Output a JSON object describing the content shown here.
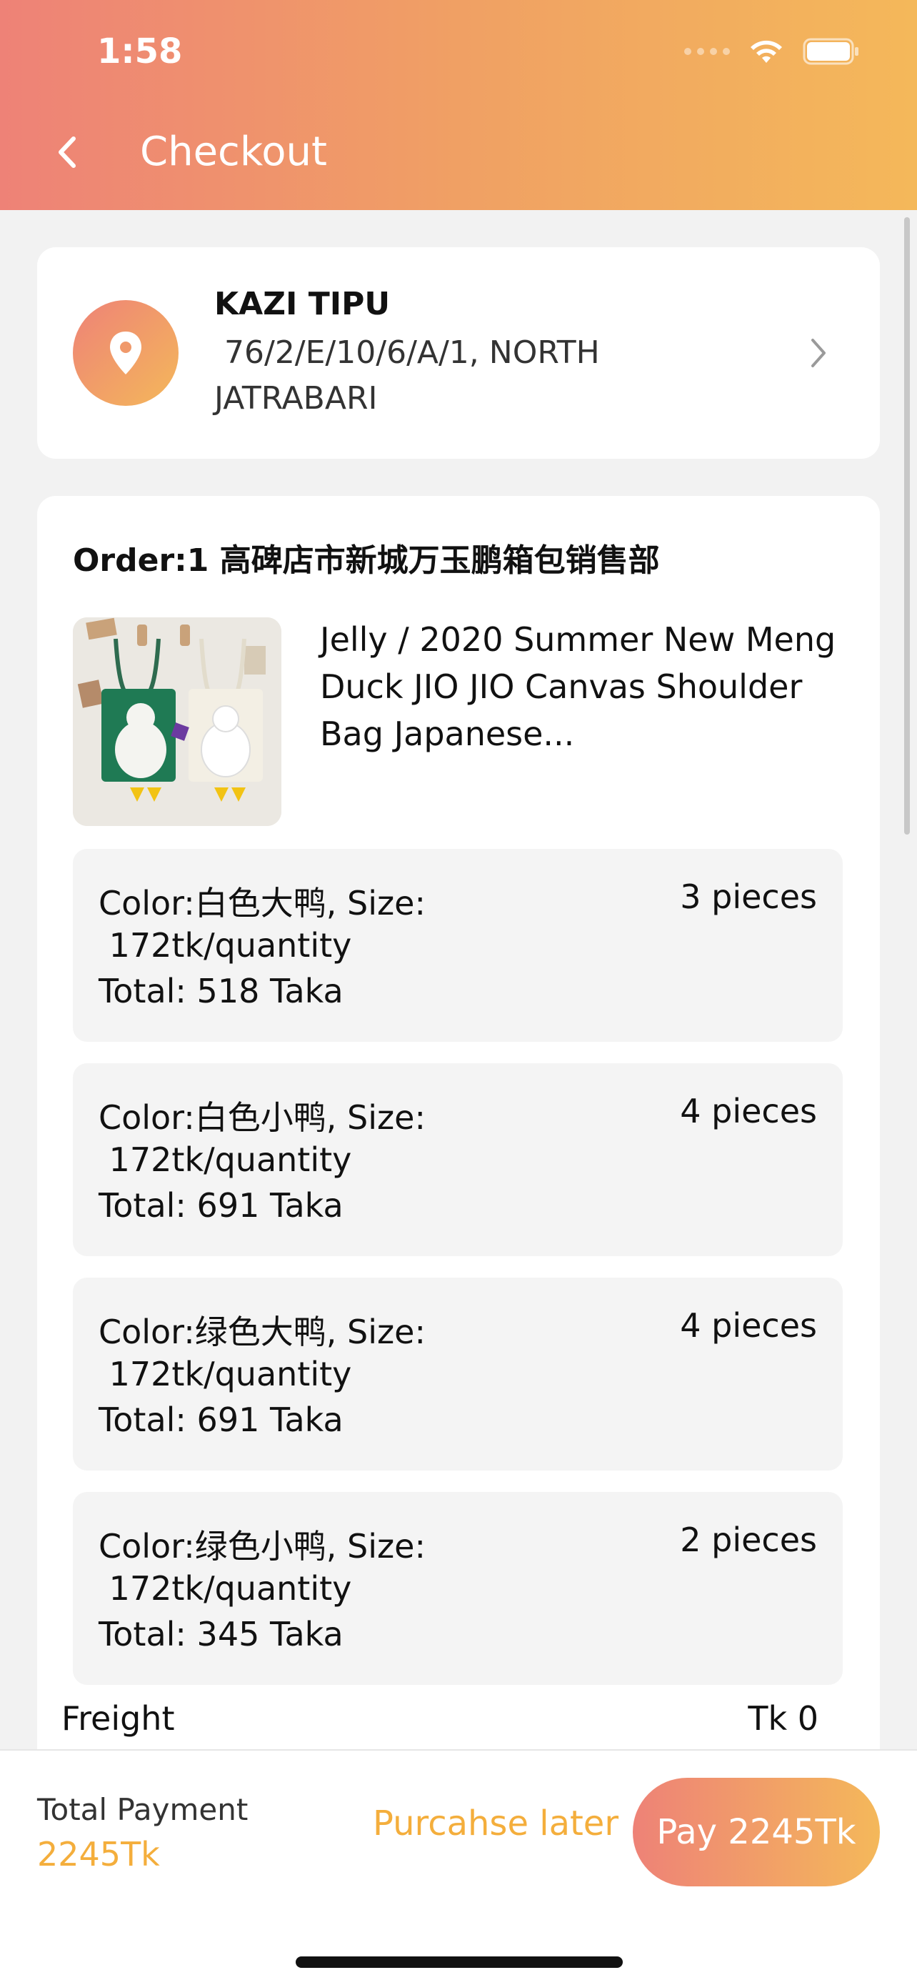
{
  "status_bar": {
    "time": "1:58"
  },
  "header": {
    "title": "Checkout"
  },
  "address": {
    "name": "KAZI TIPU",
    "line": " 76/2/E/10/6/A/1, NORTH JATRABARI"
  },
  "order": {
    "title": "Order:1 高碑店市新城万玉鹏箱包销售部",
    "product_name": "Jelly / 2020 Summer New Meng Duck JIO JIO Canvas Shoulder Bag Japanese...",
    "variants": [
      {
        "color_size": "Color:白色大鸭, Size:",
        "unit_price": " 172tk/quantity",
        "total": "Total: 518 Taka",
        "qty": "3 pieces"
      },
      {
        "color_size": "Color:白色小鸭, Size:",
        "unit_price": " 172tk/quantity",
        "total": "Total: 691 Taka",
        "qty": "4 pieces"
      },
      {
        "color_size": "Color:绿色大鸭, Size:",
        "unit_price": " 172tk/quantity",
        "total": "Total: 691 Taka",
        "qty": "4 pieces"
      },
      {
        "color_size": "Color:绿色小鸭, Size:",
        "unit_price": " 172tk/quantity",
        "total": "Total: 345 Taka",
        "qty": "2 pieces"
      }
    ],
    "freight_label": "Freight",
    "freight_value": "Tk 0"
  },
  "footer": {
    "total_label": "Total Payment",
    "total_value": "2245Tk",
    "later_label": "Purcahse later",
    "pay_label": "Pay 2245Tk"
  },
  "colors": {
    "gradient_start": "#ee8277",
    "gradient_end": "#f4b85a",
    "accent_text": "#f4ae3c"
  },
  "icons": {
    "back": "chevron-left-icon",
    "location": "location-pin-icon",
    "address_more": "chevron-right-icon",
    "wifi": "wifi-icon",
    "battery": "battery-icon"
  }
}
